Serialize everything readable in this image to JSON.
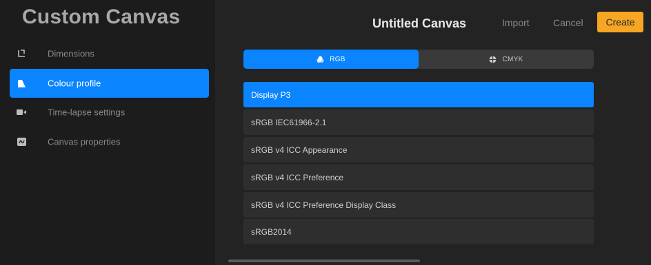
{
  "sidebar": {
    "title": "Custom Canvas",
    "items": [
      {
        "label": "Dimensions",
        "icon": "dimensions-icon"
      },
      {
        "label": "Colour profile",
        "icon": "colour-profile-icon"
      },
      {
        "label": "Time-lapse settings",
        "icon": "video-camera-icon"
      },
      {
        "label": "Canvas properties",
        "icon": "canvas-properties-icon"
      }
    ],
    "active_index": 1
  },
  "header": {
    "title": "Untitled Canvas",
    "import_label": "Import",
    "cancel_label": "Cancel",
    "create_label": "Create"
  },
  "color_mode": {
    "options": [
      {
        "label": "RGB",
        "icon": "rgb-icon"
      },
      {
        "label": "CMYK",
        "icon": "cmyk-icon"
      }
    ],
    "selected": "RGB"
  },
  "profiles": {
    "items": [
      "Display P3",
      "sRGB IEC61966-2.1",
      "sRGB v4 ICC Appearance",
      "sRGB v4 ICC Preference",
      "sRGB v4 ICC Preference Display Class",
      "sRGB2014"
    ],
    "selected": "Display P3"
  },
  "colors": {
    "accent": "#0a84ff",
    "create_button": "#f6a623",
    "sidebar_bg": "#1c1c1c",
    "main_bg": "#232323",
    "row_bg": "#2e2e2e"
  }
}
